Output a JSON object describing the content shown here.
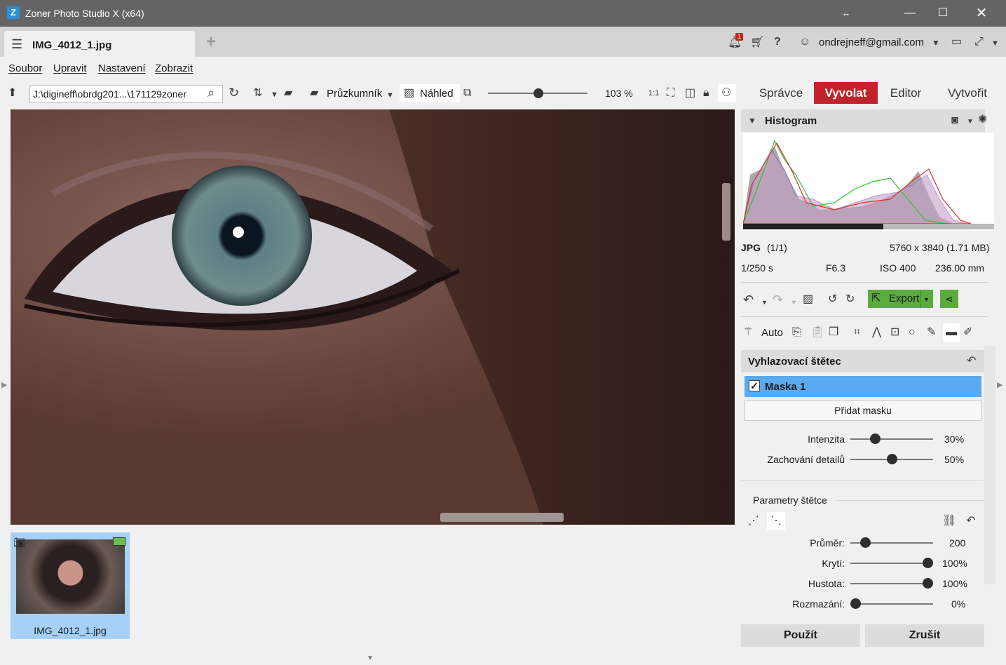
{
  "window": {
    "title": "Zoner Photo Studio X (x64)"
  },
  "tab": {
    "filename": "IMG_4012_1.jpg"
  },
  "header": {
    "notif_count": "1",
    "user_email": "ondrejneff@gmail.com"
  },
  "menu": [
    "Soubor",
    "Upravit",
    "Nastavení",
    "Zobrazit"
  ],
  "toolbar": {
    "path": "J:\\digineff\\obrdg201...\\171129zoner",
    "browser_label": "Průzkumník",
    "preview_label": "Náhled",
    "zoom": "103 %"
  },
  "modes": [
    "Správce",
    "Vyvolat",
    "Editor",
    "Vytvořit"
  ],
  "histogram": {
    "title": "Histogram"
  },
  "file_info": {
    "format": "JPG",
    "index": "(1/1)",
    "dimensions": "5760 x 3840 (1.71 MB)",
    "shutter": "1/250 s",
    "aperture": "F6.3",
    "iso": "ISO 400",
    "focal": "236.00 mm"
  },
  "edit_bar": {
    "export_label": "Export",
    "auto_label": "Auto"
  },
  "brush": {
    "title": "Vyhlazovací štětec",
    "mask_label": "Maska 1",
    "add_mask": "Přidat masku",
    "intensity_label": "Intenzita",
    "intensity_value": "30%",
    "intensity_level": 0.3,
    "detail_label": "Zachování detailů",
    "detail_value": "50%",
    "detail_level": 0.5,
    "params_title": "Parametry štětce",
    "diameter_label": "Průměr:",
    "diameter_value": "200",
    "opacity_label": "Krytí:",
    "opacity_value": "100%",
    "density_label": "Hustota:",
    "density_value": "100%",
    "blur_label": "Rozmazání:",
    "blur_value": "0%"
  },
  "actions": {
    "apply": "Použít",
    "cancel": "Zrušit"
  },
  "thumbnail": {
    "label": "IMG_4012_1.jpg"
  },
  "colors": {
    "accent": "#c0242a",
    "selection": "#5aaaf0",
    "export": "#5aac3c"
  }
}
